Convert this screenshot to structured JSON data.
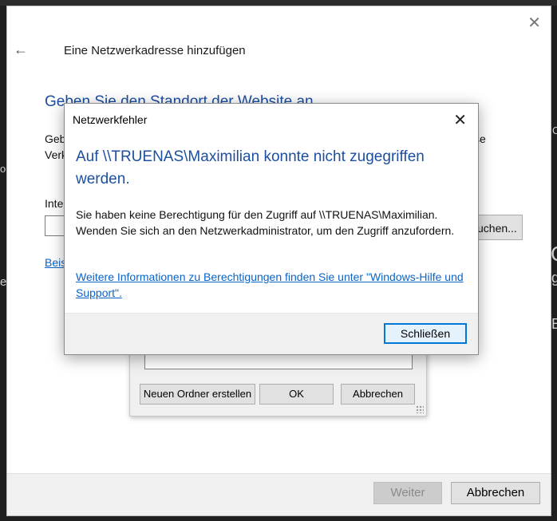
{
  "background": {
    "right_chars": [
      "C",
      "g",
      "B",
      "O"
    ],
    "left_chars": [
      "o",
      "e"
    ]
  },
  "wizard": {
    "title": "Eine Netzwerkadresse hinzufügen",
    "heading": "Geben Sie den Standort der Website an",
    "description_line1": "Geb",
    "description_line2": "Verk",
    "description_tail": "se",
    "field_label": "Inte",
    "browse_label": "uchen...",
    "example_link": "Beis",
    "next_label": "Weiter",
    "cancel_label": "Abbrechen"
  },
  "folder_dialog": {
    "new_folder_label": "Neuen Ordner erstellen",
    "ok_label": "OK",
    "cancel_label": "Abbrechen"
  },
  "error_dialog": {
    "title": "Netzwerkfehler",
    "heading": "Auf \\\\TRUENAS\\Maximilian konnte nicht zugegriffen werden.",
    "body": "Sie haben keine Berechtigung für den Zugriff auf \\\\TRUENAS\\Maximilian. Wenden Sie sich an den Netzwerkadministrator, um den Zugriff anzufordern.",
    "link": "Weitere Informationen zu Berechtigungen finden Sie unter \"Windows-Hilfe und Support\".",
    "close_label": "Schließen"
  },
  "colors": {
    "heading_blue": "#1c4fa0",
    "link_blue": "#0a64c8",
    "focus_blue": "#0078d7"
  }
}
